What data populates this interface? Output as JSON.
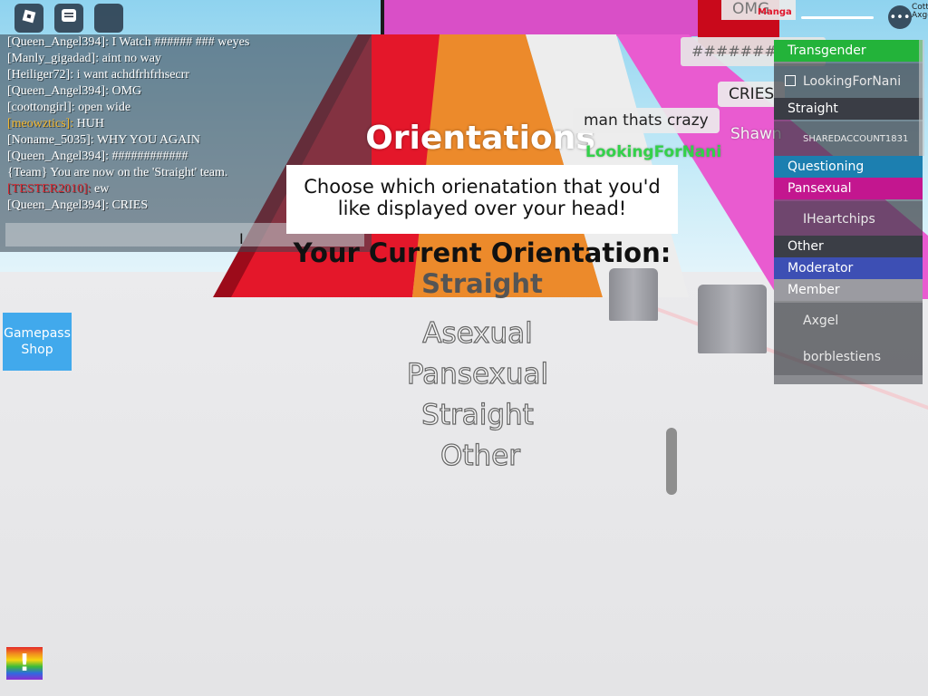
{
  "hud": {
    "roblox_icon": "roblox-logo-icon",
    "chat_icon": "chat-icon",
    "backpack_icon": "backpack-icon"
  },
  "chat": {
    "lines": [
      {
        "name": "[Queen_Angel394]:",
        "text": "I Watch ###### ### weyes",
        "color": "#ffffff"
      },
      {
        "name": "[Manly_gigadad]:",
        "text": "aint no way",
        "color": "#ffffff"
      },
      {
        "name": "[Heiliger72]:",
        "text": "i want achdfrhfrhsecrr",
        "color": "#ffffff"
      },
      {
        "name": "[Queen_Angel394]:",
        "text": "OMG",
        "color": "#ffffff"
      },
      {
        "name": "[coottongirl]:",
        "text": "open wide",
        "color": "#ffffff"
      },
      {
        "name": "[meowztics]:",
        "text": "HUH",
        "color": "#f5b82e"
      },
      {
        "name": "[Noname_5035]:",
        "text": "WHY YOU AGAIN",
        "color": "#ffffff"
      },
      {
        "name": "[Queen_Angel394]:",
        "text": "############",
        "color": "#ffffff"
      },
      {
        "name": "",
        "text": "{Team} You are now on the 'Straight' team.",
        "color": "#ffffff"
      },
      {
        "name": "[TESTER2010]:",
        "text": "ew",
        "color": "#d9262f"
      },
      {
        "name": "[Queen_Angel394]:",
        "text": "CRIES",
        "color": "#ffffff"
      }
    ],
    "input_placeholder": ""
  },
  "gamepass": {
    "label": "Gamepass Shop"
  },
  "orientation_panel": {
    "title": "Orientations",
    "prompt": "Choose which orienatation that you'd like displayed over your head!",
    "current_label": "Your Current Orientation:",
    "current_value": "Straight",
    "options": [
      "Asexual",
      "Pansexual",
      "Straight",
      "Other"
    ]
  },
  "world": {
    "bubble_crazy": "man thats crazy",
    "tag_lookingfornani": "LookingForNani",
    "bubble_cries": "CRIES",
    "tag_shawn": "Shawn",
    "bubble_hash": "#########",
    "bubble_omg": "OMG",
    "top_red_tag": "Manga",
    "top_right_text": "Cottiano Axge"
  },
  "leaderboard": {
    "groups": [
      {
        "team": "Transgender",
        "color": "#23b33a",
        "players": [
          "LookingForNani"
        ]
      },
      {
        "team": "Straight",
        "color": "#3a3d45",
        "players": [
          "SHAREDACCOUNT1831"
        ]
      },
      {
        "team": "Questioning",
        "color": "#1c7fb0",
        "players": []
      },
      {
        "team": "Pansexual",
        "color": "#c3168f",
        "players": [
          "IHeartchips"
        ]
      },
      {
        "team": "Other",
        "color": "#3b3e46",
        "players": []
      },
      {
        "team": "Moderator",
        "color": "#3d4fb4",
        "players": []
      },
      {
        "team": "Member",
        "color": "#9b9ba1",
        "players": [
          "Axgel",
          "borblestiens"
        ]
      }
    ]
  },
  "colors": {
    "red_stair": "#e4172a",
    "orange_stair": "#ec8a2b",
    "pink_stair": "#e95bd0",
    "leaderboard_bg": "#3c3e46"
  },
  "emergency_button": {
    "label": "!"
  }
}
